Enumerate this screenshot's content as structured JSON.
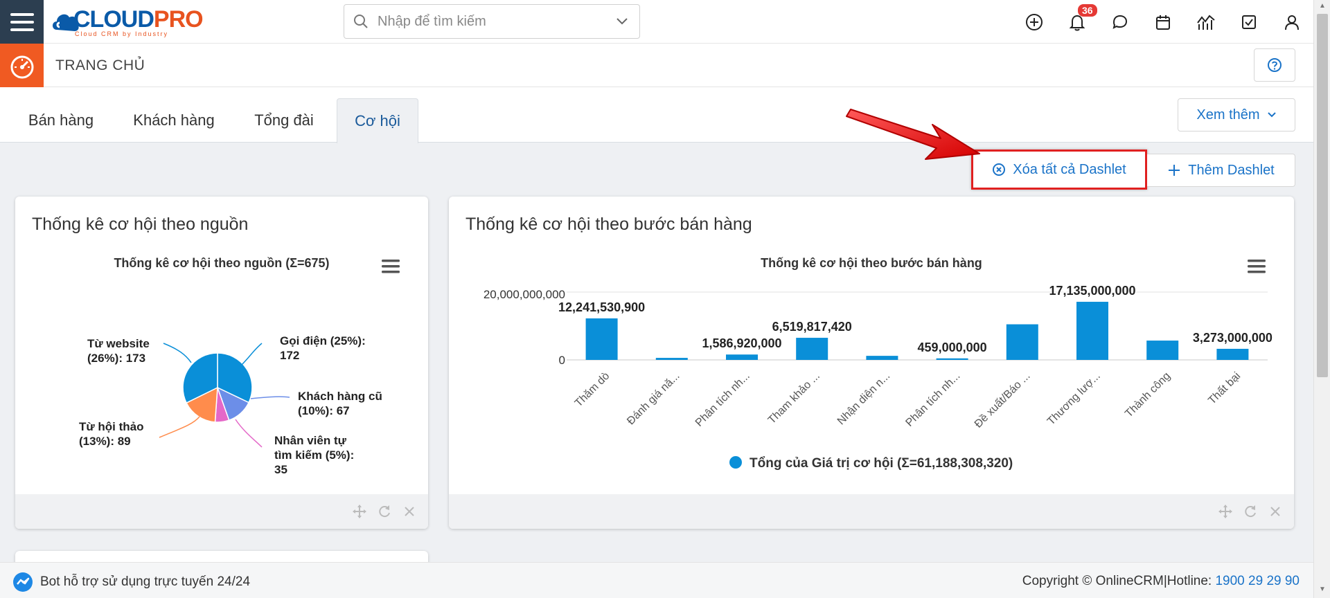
{
  "brand": {
    "logo_main": "CLOUD",
    "logo_accent": "PRO",
    "tagline": "Cloud CRM by Industry"
  },
  "search": {
    "placeholder": "Nhập để tìm kiếm"
  },
  "notifications": {
    "count": "36"
  },
  "breadcrumb": {
    "title": "TRANG CHỦ"
  },
  "tabs": [
    {
      "label": "Bán hàng"
    },
    {
      "label": "Khách hàng"
    },
    {
      "label": "Tổng đài"
    },
    {
      "label": "Cơ hội"
    }
  ],
  "more_button": {
    "label": "Xem thêm"
  },
  "actions": {
    "clear_label": "Xóa tất cả Dashlet",
    "add_label": "Thêm Dashlet"
  },
  "card_source": {
    "title": "Thống kê cơ hội theo nguồn",
    "chart_title": "Thống kê cơ hội theo nguồn (Σ=675)"
  },
  "card_stage": {
    "title": "Thống kê cơ hội theo bước bán hàng",
    "chart_title": "Thống kê cơ hội theo bước bán hàng",
    "legend": "Tổng của Giá trị cơ hội (Σ=61,188,308,320)",
    "y_ticks": [
      "20,000,000,000",
      "0"
    ]
  },
  "chart_data": [
    {
      "type": "pie",
      "title": "Thống kê cơ hội theo nguồn (Σ=675)",
      "categories": [
        "Gọi điện",
        "Khách hàng cũ",
        "Nhân viên tự tìm kiếm",
        "Từ hội thảo",
        "Từ website"
      ],
      "values": [
        172,
        67,
        35,
        89,
        173
      ],
      "labels": [
        "Gọi điện (25%): 172",
        "Khách hàng cũ (10%): 67",
        "Nhân viên tự tìm kiếm (5%): 35",
        "Từ hội thảo (13%): 89",
        "Từ website (26%): 173"
      ],
      "colors": [
        "#0a8fd8",
        "#6c8ee8",
        "#e468c8",
        "#ff8c4c",
        "#0a8fd8"
      ]
    },
    {
      "type": "bar",
      "title": "Thống kê cơ hội theo bước bán hàng",
      "categories": [
        "Thăm dò",
        "Đánh giá nă...",
        "Phân tích nh...",
        "Tham khảo ...",
        "Nhận diện n...",
        "Phân tích nh...",
        "Đề xuất/Báo ...",
        "Thương lượ...",
        "Thành công",
        "Thất bại"
      ],
      "series": [
        {
          "name": "Tổng của Giá trị cơ hội (Σ=61,188,308,320)",
          "values": [
            12241530900,
            600000000,
            1586920000,
            6519817420,
            1200000000,
            459000000,
            10500000000,
            17135000000,
            5700000000,
            3273000000
          ]
        }
      ],
      "data_labels": [
        "12,241,530,900",
        "",
        "1,586,920,000",
        "6,519,817,420",
        "",
        "459,000,000",
        "",
        "17,135,000,000",
        "",
        "3,273,000,000"
      ],
      "ylim": [
        0,
        20000000000
      ],
      "y_ticks": [
        "20,000,000,000",
        "0"
      ],
      "color": "#0a8fd8",
      "legend": "bottom-center"
    }
  ],
  "footer": {
    "bot_text": "Bot hỗ trợ sử dụng trực tuyến 24/24",
    "copyright": "Copyright © OnlineCRM",
    "separator": "|",
    "hotline_label": "Hotline: ",
    "hotline_number": "1900 29 29 90"
  }
}
